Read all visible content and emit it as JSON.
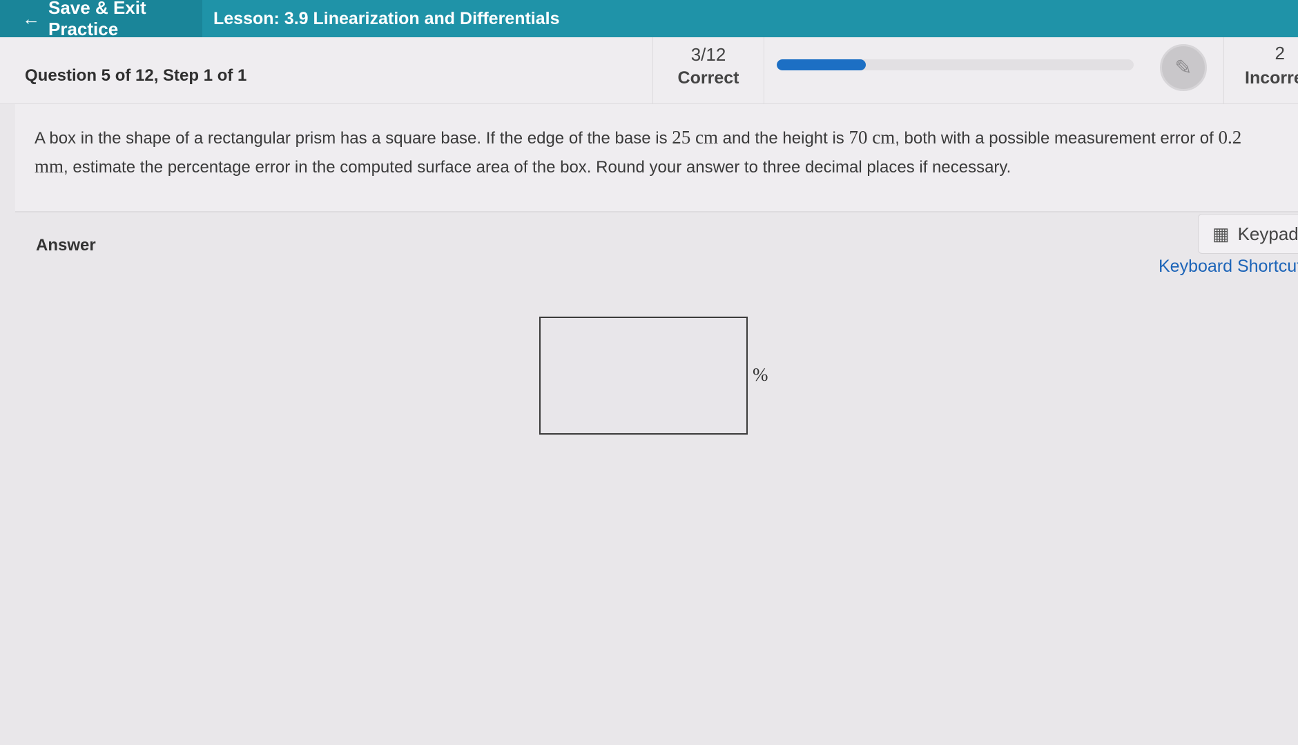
{
  "topbar": {
    "exit_label": "Save & Exit Practice",
    "lesson_title": "Lesson: 3.9 Linearization and Differentials"
  },
  "header": {
    "question_label": "Question 5 of 12,  Step 1 of 1",
    "correct_count": "3/12",
    "correct_label": "Correct",
    "progress_fraction": 0.25,
    "incorrect_count": "2",
    "incorrect_label": "Incorrect"
  },
  "question": {
    "part1": "A box in the shape of a rectangular prism has a square base. If the edge of the base is ",
    "math1": "25 cm",
    "part2": " and the height is ",
    "math2": "70 cm",
    "part3": ", both with a possible measurement error of ",
    "math3": "0.2 mm",
    "part4": ", estimate the percentage error in the computed surface area of the box. Round your answer to three decimal places if necessary."
  },
  "answer": {
    "label": "Answer",
    "input_value": "",
    "unit": "%",
    "keypad_label": "Keypad",
    "shortcuts_label": "Keyboard Shortcuts"
  },
  "icons": {
    "back": "left-arrow",
    "record": "pencil-circle",
    "keypad": "calculator"
  }
}
